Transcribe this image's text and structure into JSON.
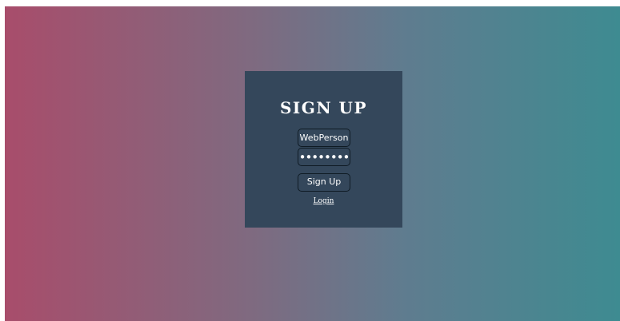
{
  "form": {
    "title": "SIGN UP",
    "username_value": "WebPerson",
    "password_value": "••••••••",
    "submit_label": "Sign Up",
    "login_link": "Login"
  }
}
